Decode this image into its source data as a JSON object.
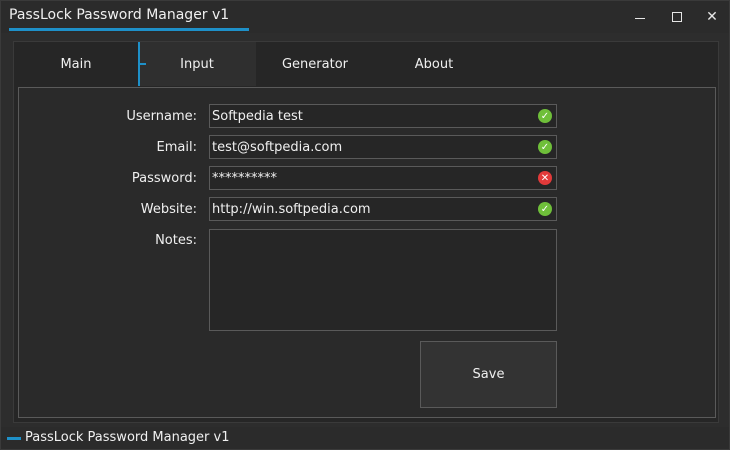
{
  "window": {
    "title": "PassLock Password Manager v1",
    "accent_color": "#1e90c8"
  },
  "titlebar_buttons": {
    "minimize_icon": "minimize-icon",
    "maximize_icon": "maximize-icon",
    "close_icon": "close-icon",
    "close_glyph": "✕"
  },
  "tabs": [
    {
      "label": "Main",
      "selected": false
    },
    {
      "label": "Input",
      "selected": true
    },
    {
      "label": "Generator",
      "selected": false
    },
    {
      "label": "About",
      "selected": false
    }
  ],
  "form": {
    "username": {
      "label": "Username:",
      "value": "Softpedia test",
      "status": "valid",
      "status_glyph": "✓"
    },
    "email": {
      "label": "Email:",
      "value": "test@softpedia.com",
      "status": "valid",
      "status_glyph": "✓"
    },
    "password": {
      "label": "Password:",
      "value": "**********",
      "status": "invalid",
      "status_glyph": "✕"
    },
    "website": {
      "label": "Website:",
      "value": "http://win.softpedia.com",
      "status": "valid",
      "status_glyph": "✓"
    },
    "notes": {
      "label": "Notes:",
      "value": ""
    },
    "save_label": "Save"
  },
  "colors": {
    "valid": "#6fbf3a",
    "invalid": "#e23a3a"
  },
  "statusbar": {
    "text": "PassLock Password Manager v1"
  }
}
